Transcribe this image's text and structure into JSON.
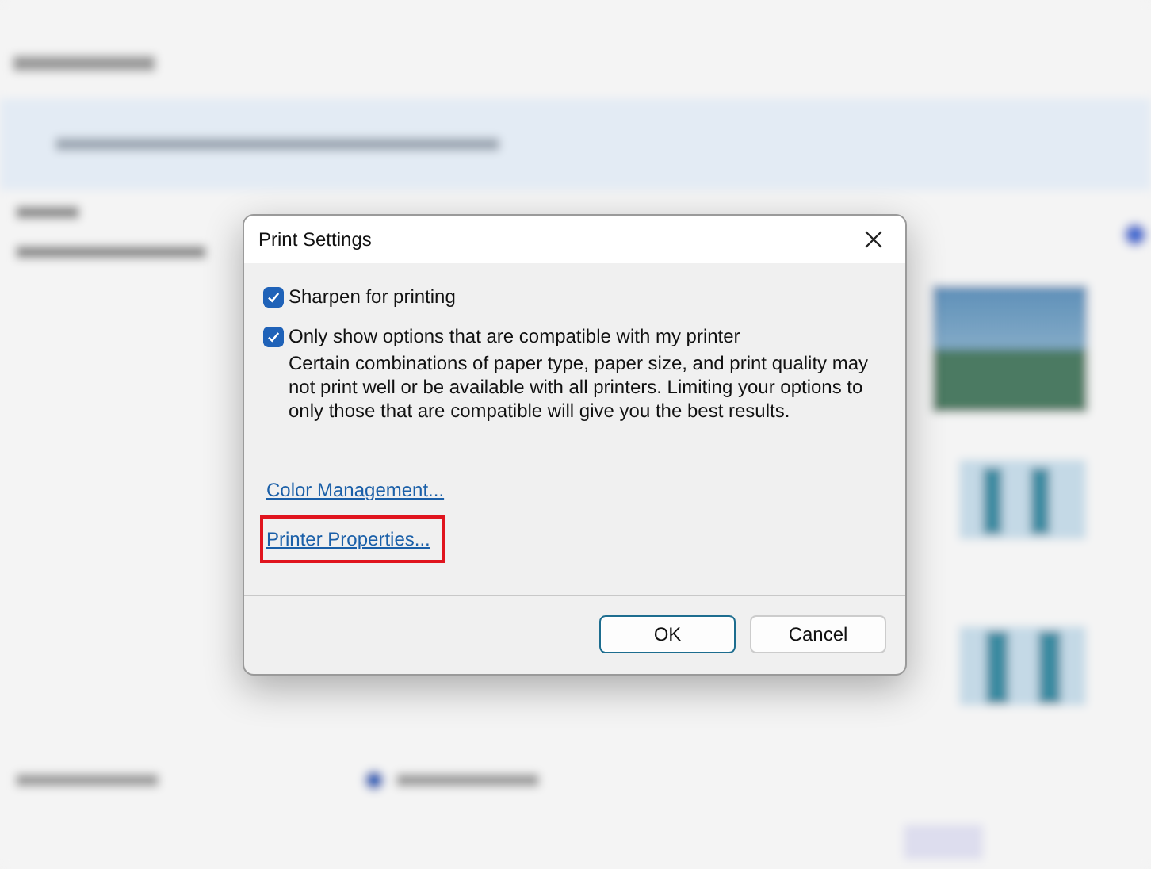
{
  "dialog": {
    "title": "Print Settings",
    "options": [
      {
        "label": "Sharpen for printing",
        "checked": true
      },
      {
        "label": "Only show options that are compatible with my printer",
        "checked": true,
        "description": "Certain combinations of paper type, paper size, and print quality may not print well or be available with all printers.  Limiting your options to only those that are compatible will give you the best results."
      }
    ],
    "links": [
      {
        "label": "Color Management...",
        "highlighted": false
      },
      {
        "label": "Printer Properties...",
        "highlighted": true
      }
    ],
    "buttons": [
      {
        "label": "OK",
        "kind": "default"
      },
      {
        "label": "Cancel",
        "kind": "normal"
      }
    ]
  }
}
